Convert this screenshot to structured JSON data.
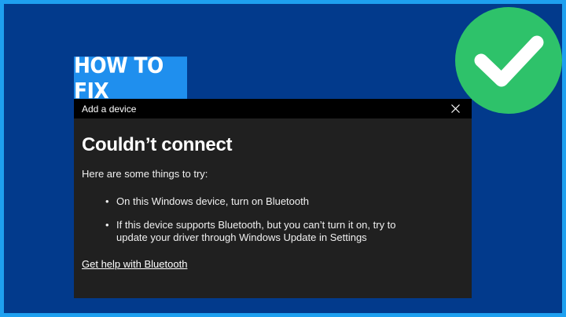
{
  "banner": {
    "label": "HOW TO FIX"
  },
  "badge": {
    "icon": "checkmark-icon",
    "color": "#2ec26a"
  },
  "dialog": {
    "title": "Add a device",
    "close_icon": "close-icon",
    "heading": "Couldn’t connect",
    "intro": "Here are some things to try:",
    "tips": [
      {
        "text": "On this Windows device, turn on Bluetooth"
      },
      {
        "text": "If this device supports Bluetooth, but you can’t turn it on, try to update your driver through Windows Update in Settings"
      }
    ],
    "help_link": "Get help with Bluetooth"
  },
  "colors": {
    "background": "#023a8c",
    "border": "#1ea0f0",
    "banner": "#1f8fee",
    "dialog": "#202020",
    "titlebar": "#000000"
  }
}
